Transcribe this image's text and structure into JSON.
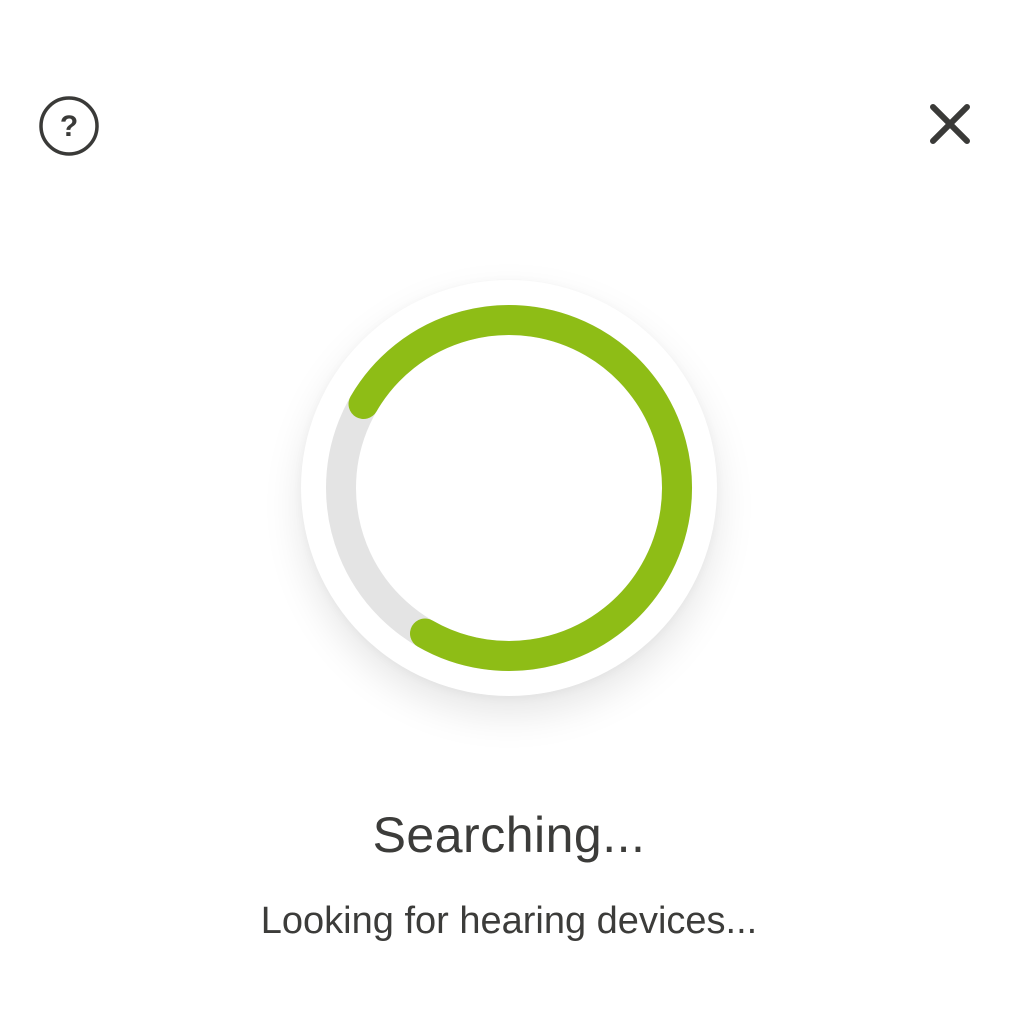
{
  "header": {
    "help_icon": "question-circle-icon",
    "help_glyph": "?",
    "close_icon": "close-icon"
  },
  "spinner": {
    "progress": 0.75,
    "accent_color": "#8ebd16",
    "track_color": "#e4e4e4"
  },
  "status": {
    "title": "Searching...",
    "subtitle": "Looking for hearing devices..."
  }
}
